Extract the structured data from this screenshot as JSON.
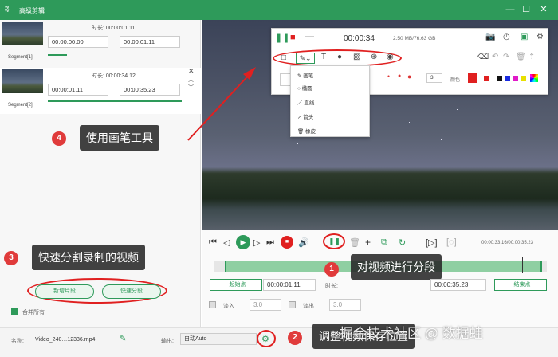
{
  "window": {
    "title": "高级剪辑",
    "logo_icon": "rabbit-logo-icon"
  },
  "segments": [
    {
      "label": "Segment[1]",
      "duration_label": "时长: 00:00:01.11",
      "start": "00:00:00.00",
      "end": "00:00:01.11"
    },
    {
      "label": "Segment[2]",
      "duration_label": "时长: 00:00:34.12",
      "start": "00:00:01.11",
      "end": "00:00:35.23"
    }
  ],
  "callouts": {
    "c1": {
      "num": "1",
      "text": "对视频进行分段"
    },
    "c2": {
      "num": "2",
      "text": "调整视频保存位置"
    },
    "c3": {
      "num": "3",
      "text": "快速分割录制的视频"
    },
    "c4": {
      "num": "4",
      "text": "使用画笔工具"
    }
  },
  "left_buttons": {
    "new_segment": "新增片段",
    "quick_split": "快速分段",
    "merge_all": "合并所有"
  },
  "recorder_toolbar": {
    "time": "00:00:34",
    "size": "2.50 MB/76.63 GB",
    "color_label": "颜色",
    "line_width": "3"
  },
  "pen_menu": [
    "画笔",
    "椭圆",
    "直线",
    "箭头",
    "橡皮"
  ],
  "timeline": {
    "time_display": "00:00:33.16/00:00:35.23"
  },
  "range": {
    "start_btn": "起始点",
    "start_val": "00:00:01.11",
    "duration_label": "时长:",
    "end_val": "00:00:35.23",
    "end_btn": "结束点"
  },
  "fade": {
    "fade_in_label": "淡入",
    "fade_in_val": "3.0",
    "fade_out_label": "淡出",
    "fade_out_val": "3.0"
  },
  "bottom": {
    "name_label": "名称:",
    "file_name": "Video_240…12336.mp4",
    "output_label": "输出:",
    "output_val": "自动Auto"
  },
  "watermark": "掘金技术社区 @ 数据蛙",
  "colors": {
    "brand_green": "#2e9a5a",
    "callout_red": "#e03b3b"
  }
}
